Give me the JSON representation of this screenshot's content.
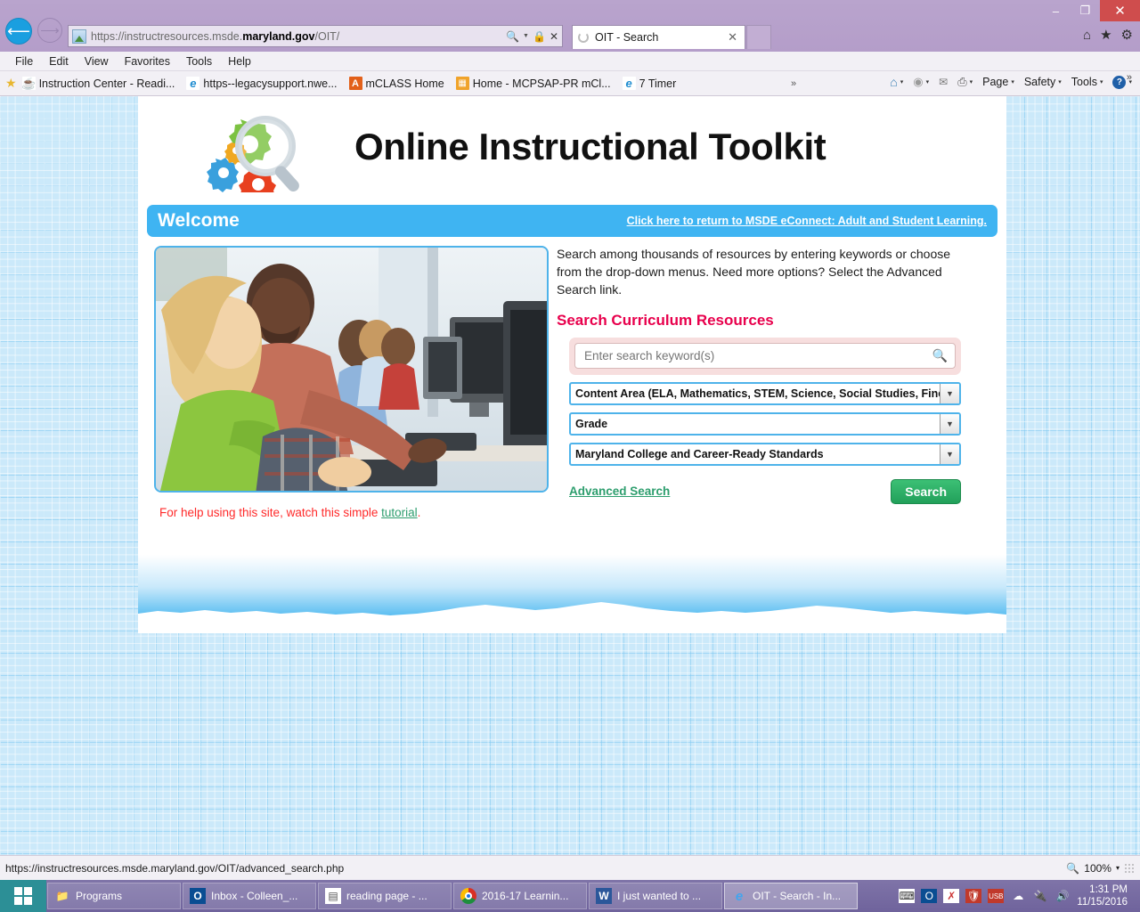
{
  "browser": {
    "address": {
      "scheme": "https://",
      "host_pre": "instructresources.msde.",
      "host_bold": "maryland.gov",
      "path": "/OIT/",
      "full": "https://instructresources.msde.maryland.gov/OIT/"
    },
    "tab": {
      "title": "OIT - Search",
      "close": "✕"
    },
    "window_controls": {
      "minimize": "–",
      "restore": "❐",
      "close": "✕"
    },
    "right_icons": {
      "home": "⌂",
      "favorites": "★",
      "tools": "⚙"
    },
    "menu": [
      "File",
      "Edit",
      "View",
      "Favorites",
      "Tools",
      "Help"
    ],
    "favorites": [
      {
        "label": "Instruction Center - Readi...",
        "icon": "nwea-icon"
      },
      {
        "label": "https--legacysupport.nwe...",
        "icon": "ie-icon"
      },
      {
        "label": "mCLASS Home",
        "icon": "amplify-icon"
      },
      {
        "label": "Home - MCPSAP-PR mCl...",
        "icon": "mcps-icon"
      },
      {
        "label": "7 Timer",
        "icon": "ie-icon"
      }
    ],
    "favorites_overflow": "»",
    "command_bar": {
      "home": "⌂",
      "feeds": "◉",
      "read_mail": "✉",
      "print": "⎙",
      "page": "Page",
      "safety": "Safety",
      "tools": "Tools",
      "help": "?",
      "overflow": "»",
      "caret": "▾"
    }
  },
  "page": {
    "brand_title": "Online Instructional Toolkit",
    "welcome": {
      "heading": "Welcome",
      "return_link": "Click here to return to MSDE eConnect: Adult and Student Learning."
    },
    "intro": "Search among thousands of resources by entering keywords or choose from the drop-down menus. Need more options? Select the Advanced Search link.",
    "section_title": "Search Curriculum Resources",
    "search": {
      "placeholder": "Enter search keyword(s)",
      "value": "",
      "icon": "search-icon"
    },
    "dropdowns": [
      {
        "name": "content-area",
        "value": "Content Area (ELA, Mathematics, STEM, Science, Social Studies, Fine Arts)"
      },
      {
        "name": "grade",
        "value": "Grade"
      },
      {
        "name": "standards",
        "value": "Maryland College and Career-Ready Standards"
      }
    ],
    "advanced_search_label": "Advanced Search",
    "search_button_label": "Search",
    "help_line": {
      "prefix": "For help using this site, watch this simple ",
      "link": "tutorial",
      "suffix": "."
    },
    "colors": {
      "accent_blue": "#3fb4f2",
      "accent_pink": "#e8004c",
      "accent_green": "#2e9e6e",
      "help_red": "#ff2a2a"
    }
  },
  "status_bar": {
    "url": "https://instructresources.msde.maryland.gov/OIT/advanced_search.php",
    "zoom": "100%",
    "zoom_caret": "▾"
  },
  "taskbar": {
    "start": "start-button",
    "items": [
      {
        "label": "Programs",
        "icon": "folder-icon"
      },
      {
        "label": "Inbox - Colleen_...",
        "icon": "outlook-icon"
      },
      {
        "label": "reading page  - ...",
        "icon": "document-icon"
      },
      {
        "label": "2016-17 Learnin...",
        "icon": "chrome-icon"
      },
      {
        "label": "I just wanted to ...",
        "icon": "word-icon"
      },
      {
        "label": "OIT - Search - In...",
        "icon": "internet-explorer-icon",
        "active": true
      }
    ],
    "tray": [
      "keyboard-icon",
      "outlook-icon",
      "excel-icon",
      "shield-icon",
      "usb-icon",
      "network-icon",
      "plug-icon",
      "volume-icon"
    ],
    "clock": {
      "time": "1:31 PM",
      "date": "11/15/2016"
    }
  }
}
